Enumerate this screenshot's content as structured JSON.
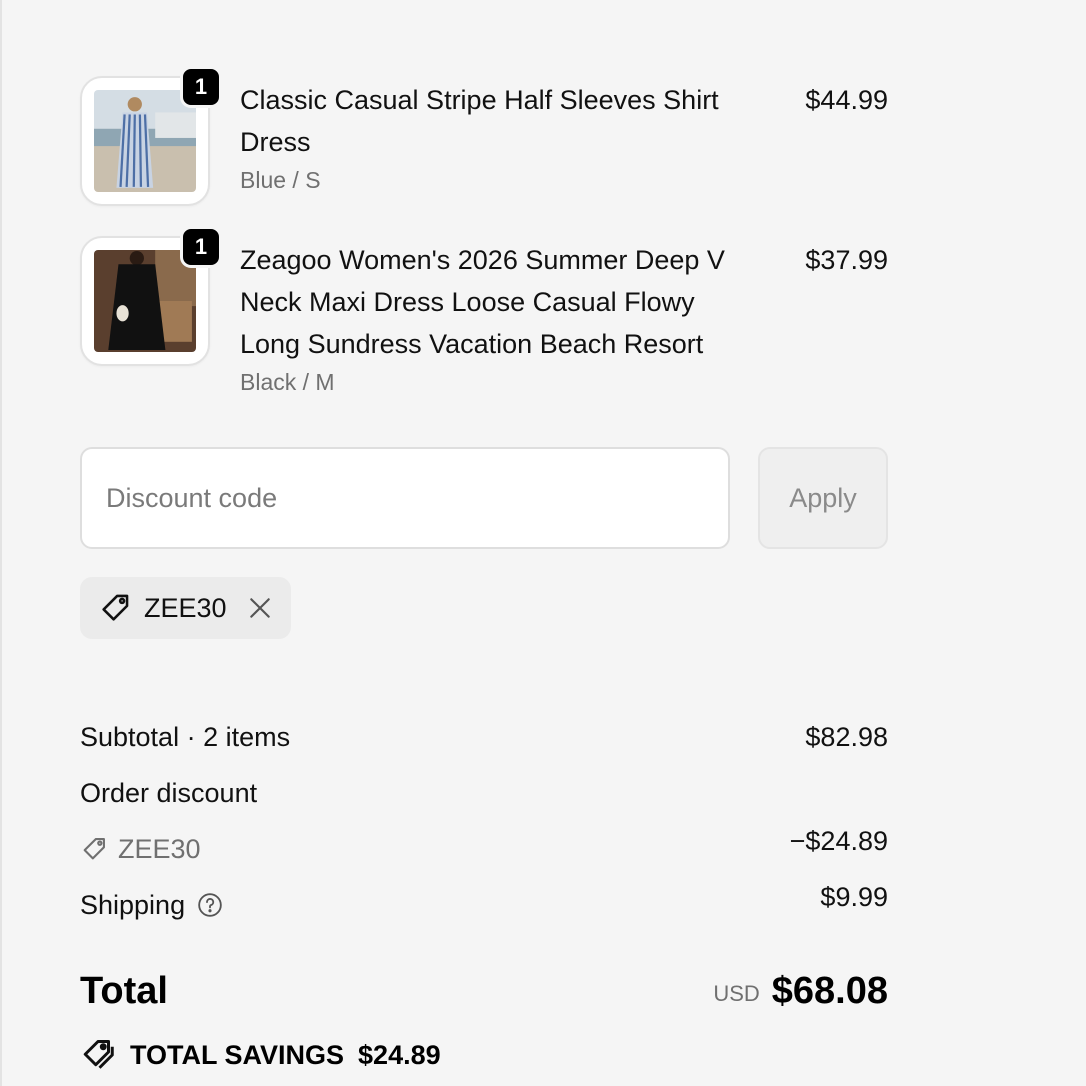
{
  "line_items": [
    {
      "quantity": "1",
      "title": "Classic Casual Stripe Half Sleeves Shirt Dress",
      "variant": "Blue / S",
      "price": "$44.99",
      "image_icon": "striped-dress-photo"
    },
    {
      "quantity": "1",
      "title": "Zeagoo Women's 2026 Summer Deep V Neck Maxi Dress Loose Casual Flowy Long Sundress Vacation Beach Resort",
      "variant": "Black / M",
      "price": "$37.99",
      "image_icon": "black-dress-photo"
    }
  ],
  "discount": {
    "placeholder": "Discount code",
    "apply_label": "Apply",
    "applied_code": "ZEE30"
  },
  "totals": {
    "subtotal_label": "Subtotal · 2 items",
    "subtotal_value": "$82.98",
    "order_discount_label": "Order discount",
    "order_discount_code": "ZEE30",
    "order_discount_value": "−$24.89",
    "shipping_label": "Shipping",
    "shipping_value": "$9.99",
    "total_label": "Total",
    "currency": "USD",
    "total_value": "$68.08",
    "savings_label": "TOTAL SAVINGS",
    "savings_value": "$24.89"
  },
  "colors": {
    "background": "#f5f5f5",
    "text": "#111111",
    "muted_text": "#707070",
    "badge": "#000000"
  }
}
